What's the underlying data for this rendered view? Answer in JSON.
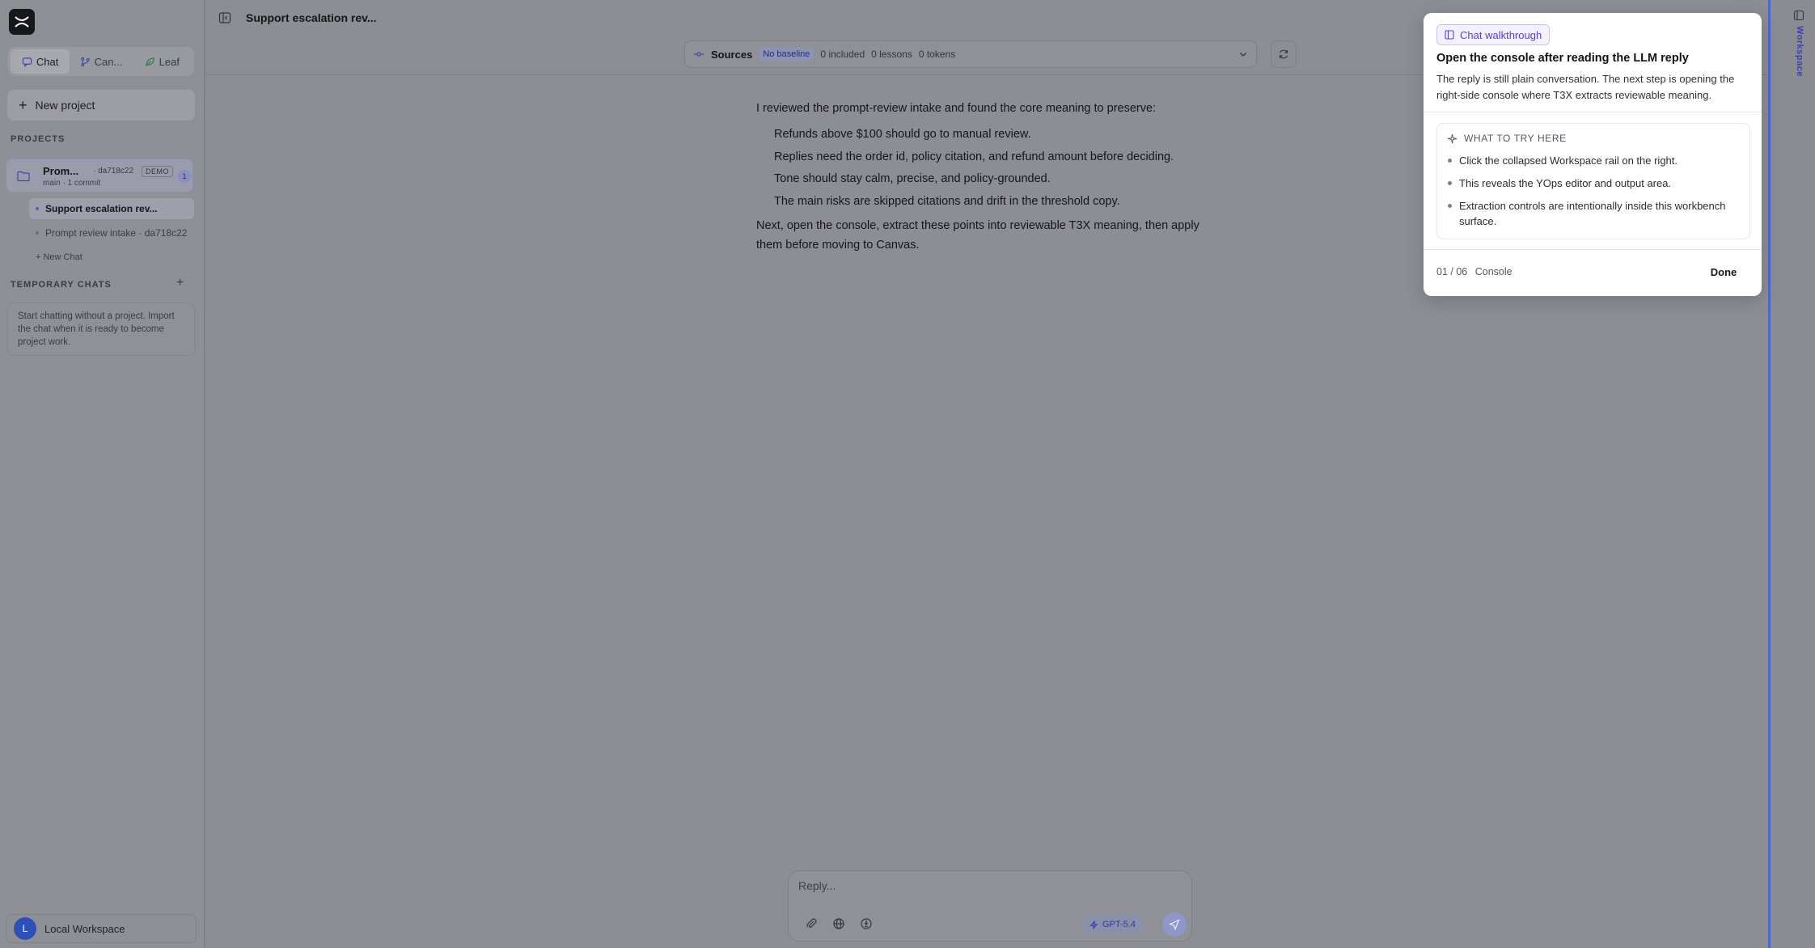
{
  "sidebar": {
    "tabs": [
      {
        "label": "Chat",
        "active": true
      },
      {
        "label": "Can..."
      },
      {
        "label": "Leaf"
      }
    ],
    "new_project_label": "New project",
    "projects_heading": "PROJECTS",
    "project": {
      "name": "Prom...",
      "hash": "· da718c22",
      "badge": "DEMO",
      "meta": "main · 1 commit",
      "count": "1"
    },
    "chats": [
      {
        "label": "Support escalation rev...",
        "active": true
      },
      {
        "label": "Prompt review intake · da718c22"
      }
    ],
    "new_chat_label": "+ New Chat",
    "temporary_heading": "TEMPORARY CHATS",
    "temporary_help": "Start chatting without a project. Import the chat when it is ready to become project work.",
    "user": {
      "initial": "L",
      "name": "Local Workspace"
    }
  },
  "header": {
    "title": "Support escalation rev..."
  },
  "sources": {
    "title": "Sources",
    "baseline_badge": "No baseline",
    "included": "0 included",
    "lessons": "0 lessons",
    "tokens": "0 tokens"
  },
  "message": {
    "intro": "I reviewed the prompt-review intake and found the core meaning to preserve:",
    "points": [
      "Refunds above $100 should go to manual review.",
      "Replies need the order id, policy citation, and refund amount before deciding.",
      "Tone should stay calm, precise, and policy-grounded.",
      "The main risks are skipped citations and drift in the threshold copy."
    ],
    "outro": "Next, open the console, extract these points into reviewable T3X meaning, then apply them before moving to Canvas."
  },
  "composer": {
    "placeholder": "Reply...",
    "model": "GPT-5.4"
  },
  "rail": {
    "label": "Workspace"
  },
  "walkthrough": {
    "chip": "Chat walkthrough",
    "title": "Open the console after reading the LLM reply",
    "description": "The reply is still plain conversation. The next step is opening the right-side console where T3X extracts reviewable meaning.",
    "try_heading": "WHAT TO TRY HERE",
    "tips": [
      "Click the collapsed Workspace rail on the right.",
      "This reveals the YOps editor and output area.",
      "Extraction controls are intentionally inside this workbench surface."
    ],
    "step": "01 / 06",
    "step_name": "Console",
    "done_label": "Done"
  },
  "colors": {
    "accent": "#5b3fd6",
    "rail_border": "#4b67d6",
    "avatar": "#2d4fb8"
  }
}
